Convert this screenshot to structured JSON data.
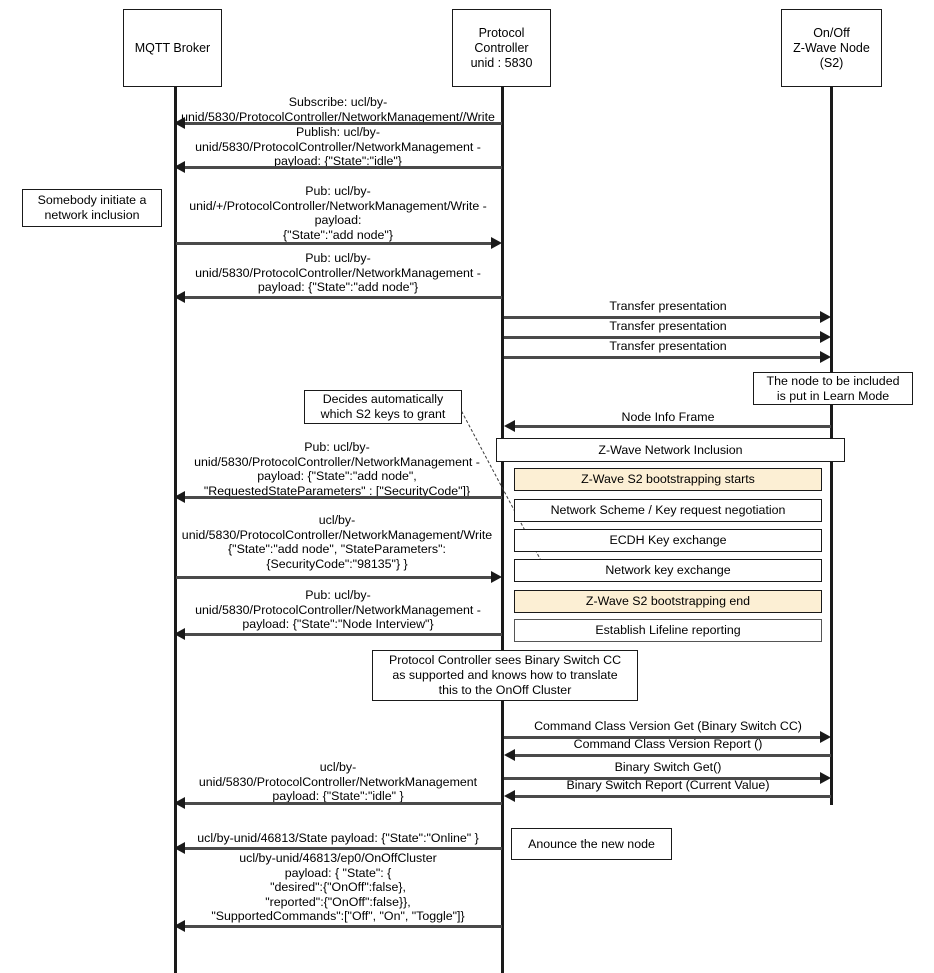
{
  "diagram": {
    "title": "Z-Wave S2 node inclusion sequence",
    "colors": {
      "line": "#1a1a1a",
      "message": "#4a4a4a",
      "highlight": "#FCEFD4",
      "background": "#ffffff"
    }
  },
  "participants": [
    {
      "id": "mqtt-broker",
      "label": "MQTT Broker"
    },
    {
      "id": "protocol-controller",
      "label": "Protocol\nController\nunid : 5830"
    },
    {
      "id": "zwave-node",
      "label": "On/Off\nZ-Wave Node\n(S2)"
    }
  ],
  "notes": [
    {
      "id": "note-initiate",
      "text": "Somebody initiate a\nnetwork inclusion"
    },
    {
      "id": "note-learn-mode",
      "text": "The node to be included\nis put in Learn Mode"
    },
    {
      "id": "note-s2-keys",
      "text": "Decides automatically\nwhich S2 keys to grant"
    },
    {
      "id": "note-binary-switch",
      "text": "Protocol Controller sees Binary Switch CC\nas supported and knows how to translate\nthis to the OnOff Cluster"
    },
    {
      "id": "note-announce",
      "text": "Anounce the new node"
    }
  ],
  "messages": [
    {
      "id": "m1",
      "text": "Subscribe: ucl/by-\nunid/5830/ProtocolController/NetworkManagement//Write",
      "from": "protocol-controller",
      "to": "mqtt-broker",
      "direction": "left"
    },
    {
      "id": "m2",
      "text": "Publish: ucl/by-\nunid/5830/ProtocolController/NetworkManagement -\npayload: {\"State\":\"idle\"}",
      "from": "protocol-controller",
      "to": "mqtt-broker",
      "direction": "left"
    },
    {
      "id": "m3",
      "text": "Pub: ucl/by-\nunid/+/ProtocolController/NetworkManagement/Write -\npayload:\n{\"State\":\"add node\"}",
      "from": "mqtt-broker",
      "to": "protocol-controller",
      "direction": "right"
    },
    {
      "id": "m4",
      "text": "Pub: ucl/by-\nunid/5830/ProtocolController/NetworkManagement -\npayload: {\"State\":\"add node\"}",
      "from": "protocol-controller",
      "to": "mqtt-broker",
      "direction": "left"
    },
    {
      "id": "m5",
      "text": "Transfer presentation",
      "from": "protocol-controller",
      "to": "zwave-node",
      "direction": "right"
    },
    {
      "id": "m6",
      "text": "Transfer presentation",
      "from": "protocol-controller",
      "to": "zwave-node",
      "direction": "right"
    },
    {
      "id": "m7",
      "text": "Transfer presentation",
      "from": "protocol-controller",
      "to": "zwave-node",
      "direction": "right"
    },
    {
      "id": "m8",
      "text": "Node Info Frame",
      "from": "zwave-node",
      "to": "protocol-controller",
      "direction": "left"
    },
    {
      "id": "m9",
      "text": "Pub: ucl/by-\nunid/5830/ProtocolController/NetworkManagement -\npayload: {\"State\":\"add node\",\n\"RequestedStateParameters\" : [\"SecurityCode\"]}",
      "from": "protocol-controller",
      "to": "mqtt-broker",
      "direction": "left"
    },
    {
      "id": "m10",
      "text": "ucl/by-\nunid/5830/ProtocolController/NetworkManagement/Write\n{\"State\":\"add node\", \"StateParameters\":\n{SecurityCode\":\"98135\"} }",
      "from": "mqtt-broker",
      "to": "protocol-controller",
      "direction": "right"
    },
    {
      "id": "m11",
      "text": "Pub: ucl/by-\nunid/5830/ProtocolController/NetworkManagement -\npayload: {\"State\":\"Node Interview\"}",
      "from": "protocol-controller",
      "to": "mqtt-broker",
      "direction": "left"
    },
    {
      "id": "m12",
      "text": "Command Class Version Get (Binary Switch CC)",
      "from": "protocol-controller",
      "to": "zwave-node",
      "direction": "right"
    },
    {
      "id": "m13",
      "text": "Command Class Version Report ()",
      "from": "zwave-node",
      "to": "protocol-controller",
      "direction": "left"
    },
    {
      "id": "m14",
      "text": "Binary Switch Get()",
      "from": "protocol-controller",
      "to": "zwave-node",
      "direction": "right"
    },
    {
      "id": "m15",
      "text": "Binary Switch Report (Current Value)",
      "from": "zwave-node",
      "to": "protocol-controller",
      "direction": "left"
    },
    {
      "id": "m16",
      "text": "ucl/by-\nunid/5830/ProtocolController/NetworkManagement\npayload: {\"State\":\"idle\" }",
      "from": "protocol-controller",
      "to": "mqtt-broker",
      "direction": "left"
    },
    {
      "id": "m17",
      "text": "ucl/by-unid/46813/State payload: {\"State\":\"Online\" }",
      "from": "protocol-controller",
      "to": "mqtt-broker",
      "direction": "left"
    },
    {
      "id": "m18",
      "text": "ucl/by-unid/46813/ep0/OnOffCluster\npayload:  { \"State\": {\n\"desired\":{\"OnOff\":false},\n\"reported\":{\"OnOff\":false}},\n\"SupportedCommands\":[\"Off\", \"On\", \"Toggle\"]}",
      "from": "protocol-controller",
      "to": "mqtt-broker",
      "direction": "left"
    }
  ],
  "frames": [
    {
      "id": "frame-inclusion",
      "label": "Z-Wave Network Inclusion",
      "highlight": false
    },
    {
      "id": "frame-s2-start",
      "label": "Z-Wave S2 bootstrapping starts",
      "highlight": true
    },
    {
      "id": "frame-scheme",
      "label": "Network Scheme / Key request negotiation",
      "highlight": false
    },
    {
      "id": "frame-ecdh",
      "label": "ECDH Key exchange",
      "highlight": false
    },
    {
      "id": "frame-netkey",
      "label": "Network key exchange",
      "highlight": false
    },
    {
      "id": "frame-s2-end",
      "label": "Z-Wave S2 bootstrapping end",
      "highlight": true
    },
    {
      "id": "frame-lifeline",
      "label": "Establish Lifeline reporting",
      "highlight": false
    }
  ]
}
